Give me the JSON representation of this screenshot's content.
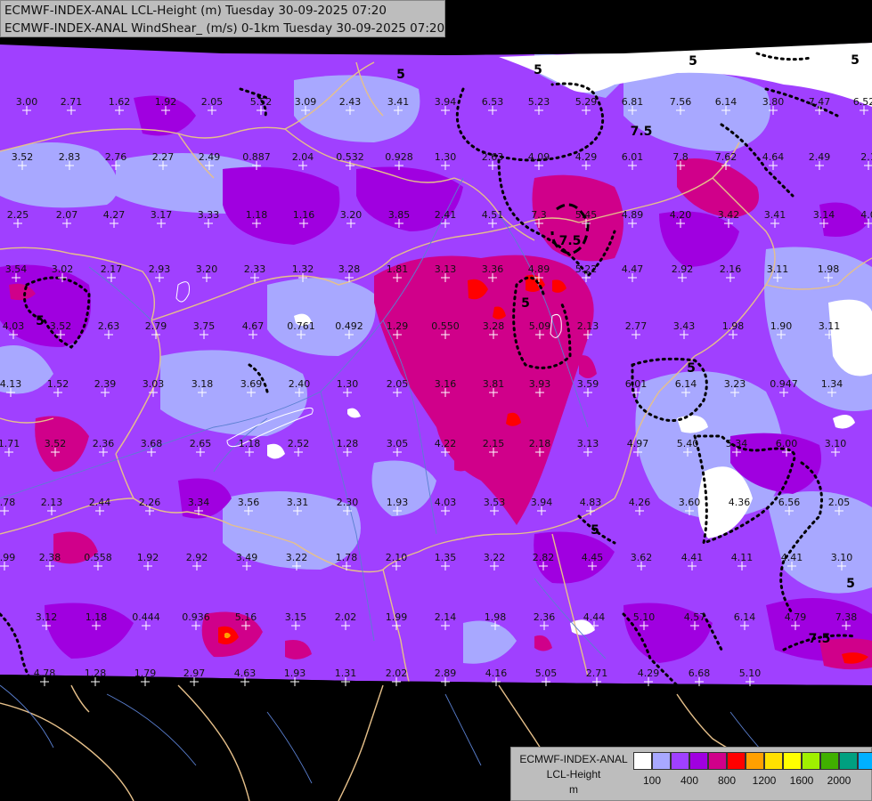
{
  "header": {
    "line1": "ECMWF-INDEX-ANAL LCL-Height (m) Tuesday 30-09-2025 07:20",
    "line2": "ECMWF-INDEX-ANAL WindShear_ (m/s) 0-1km Tuesday 30-09-2025 07:20"
  },
  "legend": {
    "model": "ECMWF-INDEX-ANAL",
    "parameter": "LCL-Height",
    "unit": "m",
    "colors": [
      "#ffffff",
      "#a8a8ff",
      "#a040ff",
      "#a000e0",
      "#d0008a",
      "#ff0000",
      "#ffa000",
      "#ffe000",
      "#ffff00",
      "#a0f000",
      "#40b000",
      "#00a080",
      "#00b0ff"
    ],
    "ticks": [
      "100",
      "400",
      "800",
      "1200",
      "1600",
      "2000"
    ]
  },
  "contour_labels": [
    "5",
    "5",
    "7.5",
    "7.5",
    "5",
    "5",
    "5",
    "5",
    "7.5",
    "5",
    "5",
    "5"
  ],
  "station_values": [
    "3.00",
    "2.71",
    "1.62",
    "1.92",
    "2.05",
    "5.52",
    "3.09",
    "2.43",
    "3.41",
    "3.94",
    "6.53",
    "5.23",
    "5.29",
    "6.81",
    "7.56",
    "6.14",
    "3.80",
    "7.47",
    "6.52",
    "3.52",
    "2.83",
    "2.76",
    "2.27",
    "2.49",
    "0.887",
    "2.04",
    "0.532",
    "0.928",
    "1.30",
    "2.63",
    "4.09",
    "4.29",
    "6.01",
    "7.8",
    "7.62",
    "4.64",
    "2.49",
    "2.1",
    "2.25",
    "2.07",
    "4.27",
    "3.17",
    "3.33",
    "1.18",
    "1.16",
    "3.20",
    "3.85",
    "2.41",
    "4.51",
    "7.3",
    "5.45",
    "4.89",
    "4.20",
    "3.42",
    "3.41",
    "3.14",
    "4.0",
    "3.54",
    "3.02",
    "2.17",
    "2.93",
    "3.20",
    "2.33",
    "1.32",
    "3.28",
    "1.81",
    "3.13",
    "3.36",
    "4.89",
    "5.22",
    "4.47",
    "2.92",
    "2.16",
    "3.11",
    "1.98",
    "4.03",
    "3.52",
    "2.63",
    "2.79",
    "3.75",
    "4.67",
    "0.761",
    "0.492",
    "1.29",
    "0.550",
    "3.28",
    "5.09",
    "2.13",
    "2.77",
    "3.43",
    "1.98",
    "1.90",
    "3.11",
    "4.13",
    "1.52",
    "2.39",
    "3.03",
    "3.18",
    "3.69",
    "2.40",
    "1.30",
    "2.05",
    "3.16",
    "3.81",
    "3.93",
    "3.59",
    "6.01",
    "6.14",
    "3.23",
    "0.947",
    "1.34",
    "1.71",
    "3.52",
    "2.36",
    "3.68",
    "2.65",
    "1.18",
    "2.52",
    "1.28",
    "3.05",
    "4.22",
    "2.15",
    "2.18",
    "3.13",
    "4.97",
    "5.40",
    "5.34",
    "6.00",
    "3.10",
    "1.78",
    "2.13",
    "2.44",
    "2.26",
    "3.34",
    "3.56",
    "3.31",
    "2.30",
    "1.93",
    "4.03",
    "3.53",
    "3.94",
    "4.83",
    "4.26",
    "3.60",
    "4.36",
    "6.56",
    "2.05",
    "1.99",
    "2.38",
    "0.558",
    "1.92",
    "2.92",
    "3.49",
    "3.22",
    "1.78",
    "2.10",
    "1.35",
    "3.22",
    "2.82",
    "4.45",
    "3.62",
    "4.41",
    "4.11",
    "4.41",
    "3.10",
    "3.12",
    "1.18",
    "0.444",
    "0.936",
    "5.16",
    "3.15",
    "2.02",
    "1.99",
    "2.14",
    "1.98",
    "2.36",
    "4.44",
    "5.10",
    "4.57",
    "6.14",
    "4.79",
    "7.38",
    "4.78",
    "1.28",
    "1.79",
    "2.97",
    "4.63",
    "1.93",
    "1.31",
    "2.02",
    "2.89",
    "4.16",
    "5.05",
    "2.71",
    "4.29",
    "6.68",
    "5.10"
  ]
}
